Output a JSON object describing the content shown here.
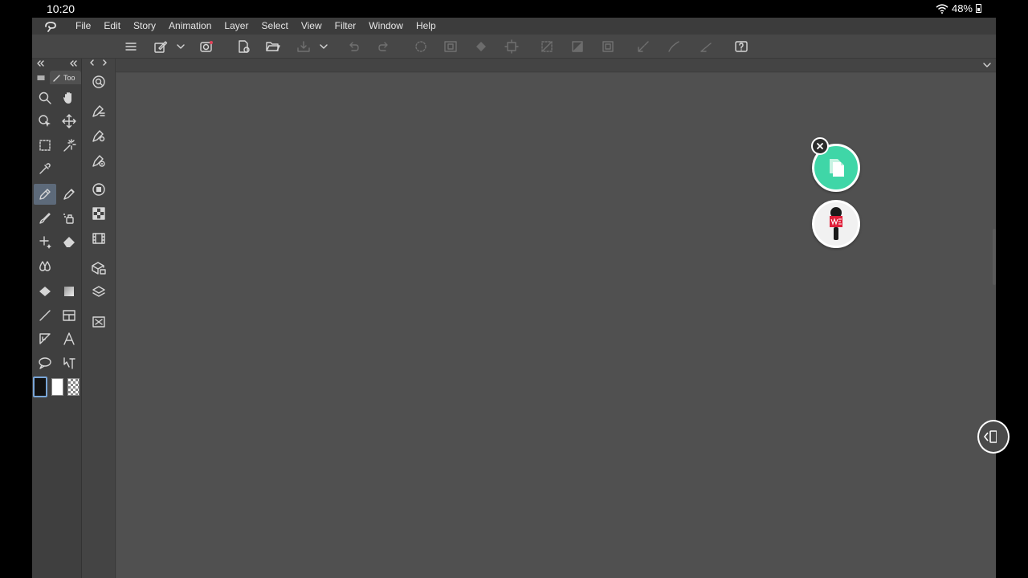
{
  "status": {
    "time": "10:20",
    "battery": "48%"
  },
  "menu": [
    "File",
    "Edit",
    "Story",
    "Animation",
    "Layer",
    "Select",
    "View",
    "Filter",
    "Window",
    "Help"
  ],
  "tool_panel": {
    "tab_label": "Too"
  },
  "colors": {
    "canvas": "#505050",
    "panel": "#3f3f3f",
    "copy_button": "#3fd6a7",
    "active_tool": "#5d6a7a"
  },
  "icons": {
    "tools": [
      "zoom",
      "hand",
      "operation",
      "move-layer",
      "marquee",
      "auto-select",
      "eyedropper",
      "pen",
      "pencil",
      "brush",
      "airbrush",
      "decoration",
      "eraser",
      "blend",
      "fill",
      "gradient",
      "figure",
      "frame-border",
      "ruler",
      "text",
      "balloon",
      "correct-line"
    ],
    "sub_tools": [
      "navigator",
      "sub-tool-detail",
      "tool-property",
      "brush-size",
      "color-wheel",
      "color-set",
      "animation-timeline",
      "material",
      "layer-property",
      "layer",
      "layer-search"
    ]
  }
}
